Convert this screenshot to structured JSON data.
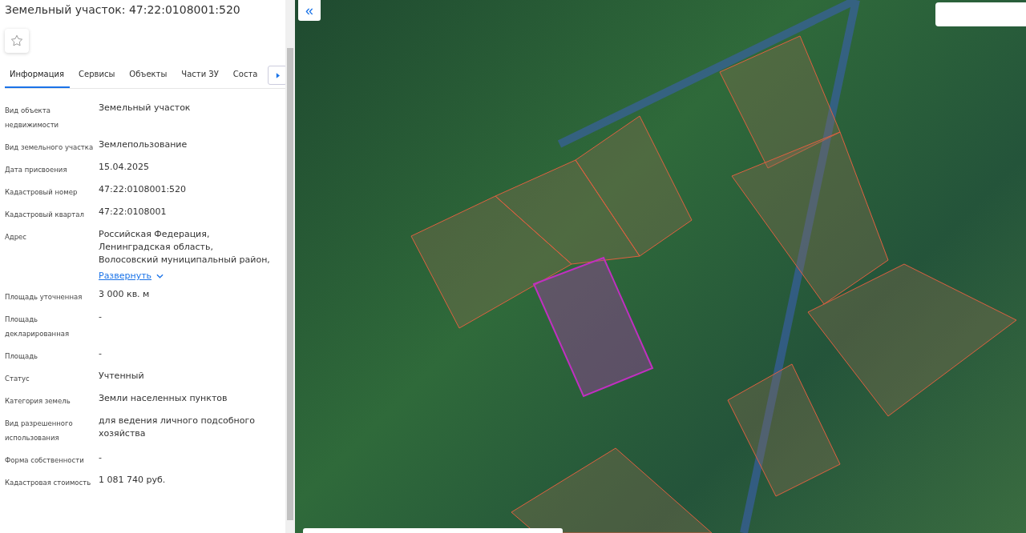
{
  "panel": {
    "title": "Земельный участок: 47:22:0108001:520",
    "favorite": {
      "checked": false
    },
    "tabs": [
      {
        "label": "Информация",
        "selected": true
      },
      {
        "label": "Сервисы",
        "selected": false
      },
      {
        "label": "Объекты",
        "selected": false
      },
      {
        "label": "Части ЗУ",
        "selected": false
      },
      {
        "label": "Соста",
        "selected": false
      }
    ],
    "rows": [
      {
        "label": "Вид объекта недвижимости",
        "value": "Земельный участок"
      },
      {
        "label": "Вид земельного участка",
        "value": "Землепользование"
      },
      {
        "label": "Дата присвоения",
        "value": "15.04.2025"
      },
      {
        "label": "Кадастровый номер",
        "value": "47:22:0108001:520"
      },
      {
        "label": "Кадастровый квартал",
        "value": "47:22:0108001"
      },
      {
        "label": "Адрес",
        "value": "Российская Федерация,\nЛенинградская область,\nВолосовский муниципальный район,",
        "link": "Развернуть"
      },
      {
        "label": "Площадь уточненная",
        "value": "3 000 кв. м"
      },
      {
        "label": "Площадь декларированная",
        "value": "-"
      },
      {
        "label": "Площадь",
        "value": "-"
      },
      {
        "label": "Статус",
        "value": "Учтенный"
      },
      {
        "label": "Категория земель",
        "value": "Земли населенных пунктов"
      },
      {
        "label": "Вид разрешенного использования",
        "value": "для ведения личного подсобного хозяйства"
      },
      {
        "label": "Форма собственности",
        "value": "-"
      },
      {
        "label": "Кадастровая стоимость",
        "value": "1 081 740 руб."
      }
    ]
  },
  "map": {
    "collapse_button": "«"
  }
}
